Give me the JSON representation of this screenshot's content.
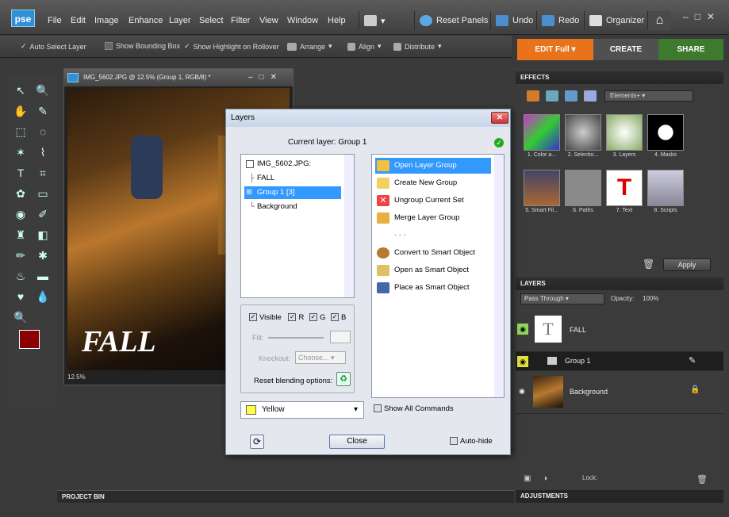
{
  "app": {
    "logo": "pse"
  },
  "menu": [
    "File",
    "Edit",
    "Image",
    "Enhance",
    "Layer",
    "Select",
    "Filter",
    "View",
    "Window",
    "Help"
  ],
  "toolbar": {
    "reset_panels": "Reset Panels",
    "undo": "Undo",
    "redo": "Redo",
    "organizer": "Organizer"
  },
  "options": {
    "auto_select": "Auto Select Layer",
    "bounding_box": "Show Bounding Box",
    "highlight": "Show Highlight on Rollover",
    "arrange": "Arrange",
    "align": "Align",
    "distribute": "Distribute"
  },
  "modes": {
    "edit": "EDIT Full",
    "create": "CREATE",
    "share": "SHARE"
  },
  "document": {
    "title": "IMG_5602.JPG @ 12.5% (Group 1, RGB/8) *",
    "zoom": "12.5%",
    "overlay_text": "FALL"
  },
  "bins": {
    "project": "PROJECT BIN",
    "adjustments": "ADJUSTMENTS"
  },
  "effects": {
    "header": "EFFECTS",
    "category": "Elements+",
    "items": [
      "1. Color a...",
      "2. Selectio...",
      "3. Layers",
      "4. Masks",
      "5. Smart Fil...",
      "6. Paths",
      "7. Text",
      "8. Scripts"
    ],
    "apply": "Apply"
  },
  "layers": {
    "header": "LAYERS",
    "blend_mode": "Pass Through",
    "opacity_label": "Opacity:",
    "opacity": "100%",
    "rows": [
      "FALL",
      "Group 1",
      "Background"
    ],
    "lock_label": "Lock:"
  },
  "dialog": {
    "title": "Layers",
    "current_layer": "Current layer: Group 1",
    "tree": [
      "IMG_5602.JPG:",
      "FALL",
      "Group 1 [3]",
      "Background"
    ],
    "commands": [
      "Open Layer Group",
      "Create New Group",
      "Ungroup Current Set",
      "Merge Layer Group",
      "- - -",
      "Convert to Smart Object",
      "Open as Smart Object",
      "Place as Smart Object"
    ],
    "visible": "Visible",
    "r": "R",
    "g": "G",
    "b": "B",
    "fill": "Fill:",
    "knockout": "Knockout:",
    "knockout_value": "Choose...",
    "reset_blending": "Reset blending options:",
    "color": "Yellow",
    "show_all": "Show All Commands",
    "close": "Close",
    "auto_hide": "Auto-hide"
  },
  "colors": {
    "accent_orange": "#e8731a",
    "create_tab": "#505050",
    "share_tab": "#3d7a2e",
    "selection_blue": "#3399ff",
    "foreground": "#8b0000"
  }
}
